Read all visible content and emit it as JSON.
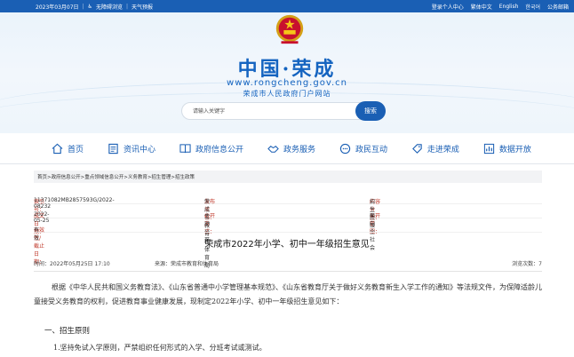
{
  "topbar": {
    "date": "2023年03月07日",
    "accessibility": "无障碍浏览",
    "weather": "天气预报",
    "links": [
      "登录个人中心",
      "繁体中文",
      "English",
      "한국어",
      "公务邮箱"
    ]
  },
  "header": {
    "title": "中国·荣成",
    "url": "www.rongcheng.gov.cn",
    "subtitle": "荣成市人民政府门户网站"
  },
  "search": {
    "placeholder": "请输入关键字",
    "button": "搜索"
  },
  "nav": [
    {
      "label": "首页",
      "icon": "home-icon"
    },
    {
      "label": "资讯中心",
      "icon": "news-icon"
    },
    {
      "label": "政府信息公开",
      "icon": "book-icon"
    },
    {
      "label": "政务服务",
      "icon": "handshake-icon"
    },
    {
      "label": "政民互动",
      "icon": "chat-icon"
    },
    {
      "label": "走进荣成",
      "icon": "tag-icon"
    },
    {
      "label": "数据开放",
      "icon": "chart-icon"
    }
  ],
  "breadcrumb": "首页>政府信息公开>重点领域信息公开>义务教育>招生管理>招生政策",
  "meta": {
    "index_label": "索引号：",
    "index": "11371082MB2857593G/2022-08232",
    "org_label": "发布单位：",
    "org": "荣成市教育和体育局",
    "category_label": "内容分类：",
    "category": "招生政策",
    "date_label": "成文日期：",
    "date": "2022-05-25",
    "mode_label": "公开方式：",
    "mode": "主动公开",
    "scope_label": "公开范围：",
    "scope": "面向全社会",
    "validity_label": "有效性/截止日期：",
    "validity": "有效"
  },
  "article": {
    "title": "荣成市2022年小学、初中一年级招生意见",
    "time": "时间：2022年05月25日 17:10",
    "source": "来源：荣成市教育和体育局",
    "views": "浏览次数：7",
    "paragraph": "根据《中华人民共和国义务教育法》、《山东省普通中小学管理基本规范》、《山东省教育厅关于做好义务教育新生入学工作的通知》等法规文件，为保障适龄儿童接受义务教育的权利，促进教育事业健康发展，现制定2022年小学、初中一年级招生意见如下：",
    "section1": "一、招生原则",
    "item1": "1.坚持免试入学原则，严禁组织任何形式的入学、分班考试或测试。"
  },
  "colors": {
    "brand": "#1a5fb4",
    "label_red": "#c0392b"
  }
}
